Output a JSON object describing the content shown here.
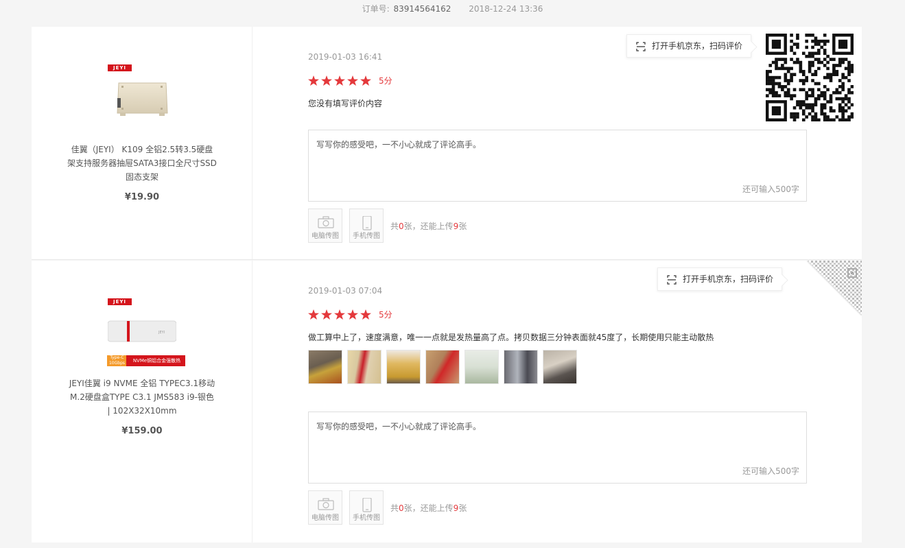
{
  "order": {
    "label": "订单号:",
    "number": "83914564162",
    "time": "2018-12-24 13:36"
  },
  "scan_tip": "打开手机京东，扫码评价",
  "reviews": [
    {
      "product": {
        "brand": "JEYI",
        "name_lines": [
          "佳翼（JEYI） K109 全铝2.5转3.5硬盘",
          "架支持服务器抽屉SATA3接口全尺寸SSD",
          "固态支架"
        ],
        "price": "¥19.90"
      },
      "date": "2019-01-03 16:41",
      "rating": 5,
      "score_text": "5分",
      "comment": "您没有填写评价内容",
      "textarea_placeholder": "写写你的感受吧，一不小心就成了评论高手。",
      "char_count": "还可输入500字",
      "upload": {
        "pc_label": "电脑传图",
        "mobile_label": "手机传图",
        "info_a": "共",
        "count": "0",
        "info_b": "张，还能上传",
        "remain": "9",
        "info_c": "张"
      }
    },
    {
      "product": {
        "brand": "JEYI",
        "badge_left": "Type-C 10Gbps",
        "badge_right": "NVMe铜铝合金强散热",
        "name_lines": [
          "JEYI佳翼 i9 NVME 全铝 TYPEC3.1移动",
          "M.2硬盘盒TYPE C3.1 JMS583 i9-银色",
          "| 102X32X10mm"
        ],
        "price": "¥159.00"
      },
      "date": "2019-01-03 07:04",
      "rating": 5,
      "score_text": "5分",
      "comment": "做工算中上了，速度满意，唯一一点就是发热量高了点。拷贝数据三分钟表面就45度了，长期使用只能主动散热",
      "photo_count": 7,
      "textarea_placeholder": "写写你的感受吧，一不小心就成了评论高手。",
      "char_count": "还可输入500字",
      "upload": {
        "pc_label": "电脑传图",
        "mobile_label": "手机传图",
        "info_a": "共",
        "count": "0",
        "info_b": "张，还能上传",
        "remain": "9",
        "info_c": "张"
      }
    }
  ],
  "colors": {
    "accent": "#e4393c",
    "brand_red": "#d4151c",
    "border": "#dddddd",
    "muted": "#999999"
  }
}
